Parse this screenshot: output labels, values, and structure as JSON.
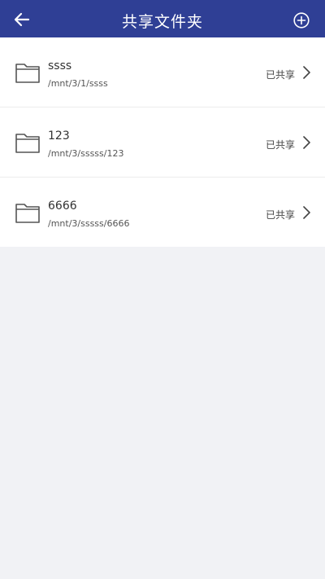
{
  "colors": {
    "header_bg": "#2f3f95",
    "page_bg": "#f1f2f5"
  },
  "header": {
    "title": "共享文件夹",
    "back_icon": "arrow-left-icon",
    "add_icon": "plus-circle-icon"
  },
  "folders": [
    {
      "name": "ssss",
      "path": "/mnt/3/1/ssss",
      "status": "已共享"
    },
    {
      "name": "123",
      "path": "/mnt/3/sssss/123",
      "status": "已共享"
    },
    {
      "name": "6666",
      "path": "/mnt/3/sssss/6666",
      "status": "已共享"
    }
  ]
}
